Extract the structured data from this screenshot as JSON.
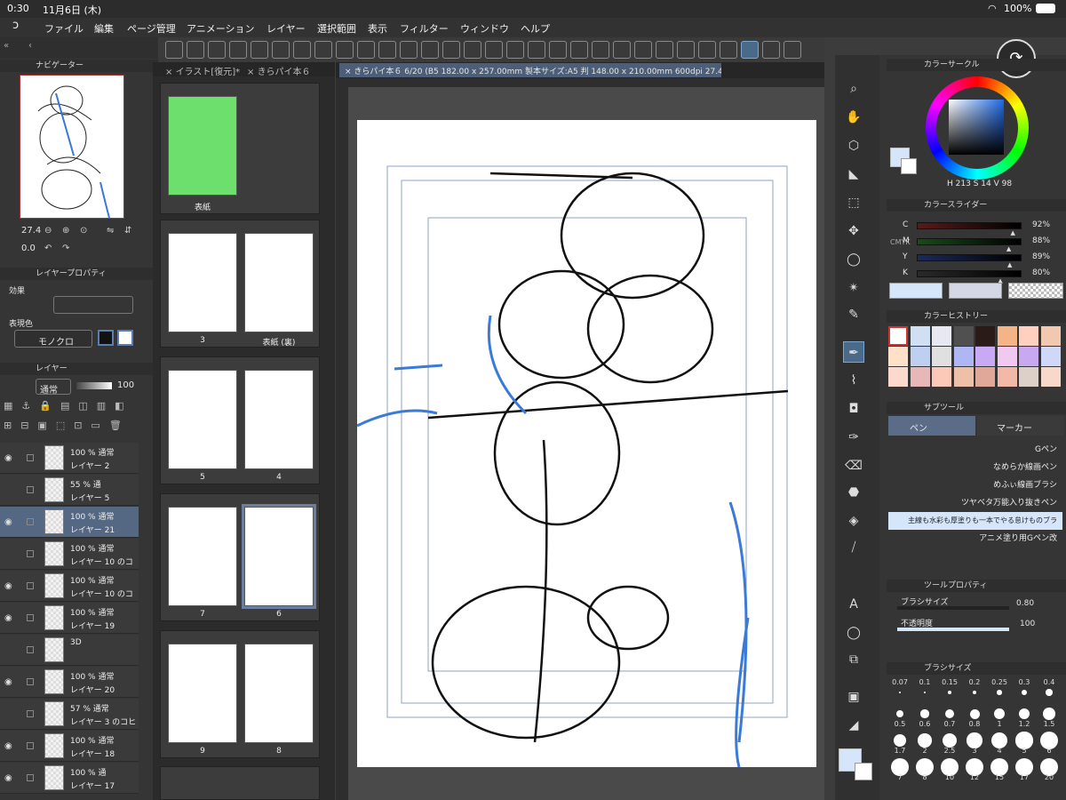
{
  "status": {
    "time": "0:30",
    "date": "11月6日 (木)",
    "battery": "100%"
  },
  "menu": [
    "ファイル",
    "編集",
    "ページ管理",
    "アニメーション",
    "レイヤー",
    "選択範囲",
    "表示",
    "フィルター",
    "ウィンドウ",
    "ヘルプ"
  ],
  "navigator": {
    "title": "ナビゲーター",
    "zoom": "27.4",
    "rotation": "0.0"
  },
  "layer_property": {
    "title": "レイヤープロパティ",
    "effect_label": "効果",
    "color_label": "表現色",
    "color_value": "モノクロ"
  },
  "layers_panel": {
    "title": "レイヤー",
    "blend": "通常",
    "opacity": "100"
  },
  "layers": [
    {
      "mode": "100 % 通常",
      "name": "レイヤー 2",
      "visible": true
    },
    {
      "mode": "55 % 通",
      "name": "レイヤー 5",
      "visible": false
    },
    {
      "mode": "100 % 通常",
      "name": "レイヤー 21",
      "visible": true,
      "selected": true
    },
    {
      "mode": "100 % 通常",
      "name": "レイヤー 10 のコ",
      "visible": false
    },
    {
      "mode": "100 % 通常",
      "name": "レイヤー 10 のコ",
      "visible": true
    },
    {
      "mode": "100 % 通常",
      "name": "レイヤー 19",
      "visible": true
    },
    {
      "mode": "3D",
      "name": "",
      "visible": false
    },
    {
      "mode": "100 % 通常",
      "name": "レイヤー 20",
      "visible": true
    },
    {
      "mode": "57 % 通常",
      "name": "レイヤー 3 のコヒ",
      "visible": false
    },
    {
      "mode": "100 % 通常",
      "name": "レイヤー 18",
      "visible": true
    },
    {
      "mode": "100 % 通",
      "name": "レイヤー 17",
      "visible": true
    }
  ],
  "tabs": [
    "イラスト[復元]*",
    "きらパイ本６"
  ],
  "doc_tab": "きらパイ本６ 6/20 (B5 182.00 x 257.00mm 製本サイズ:A5 判 148.00 x 210.00mm 600dpi 27.4%)",
  "pages": [
    {
      "label": "表紙"
    },
    {
      "label": "3"
    },
    {
      "label": "表紙 (裏)"
    },
    {
      "label": "5"
    },
    {
      "label": "4"
    },
    {
      "label": "7"
    },
    {
      "label": "6"
    },
    {
      "label": "9"
    },
    {
      "label": "8"
    }
  ],
  "color_circle": {
    "title": "カラーサークル",
    "h": "213",
    "s": "14",
    "v": "98"
  },
  "color_slider": {
    "title": "カラースライダー",
    "mode": "CMYK",
    "rows": [
      {
        "k": "C",
        "v": "92%",
        "frac": 0.92,
        "color": "#5a1a1a"
      },
      {
        "k": "M",
        "v": "88%",
        "frac": 0.88,
        "color": "#1a4a1a"
      },
      {
        "k": "Y",
        "v": "89%",
        "frac": 0.89,
        "color": "#1a2a5a"
      },
      {
        "k": "K",
        "v": "80%",
        "frac": 0.8,
        "color": "#2a2a2a"
      }
    ]
  },
  "color_history": {
    "title": "カラーヒストリー",
    "colors": [
      "#fff",
      "#d0dff4",
      "#e8e8f2",
      "#505050",
      "#2a1a18",
      "#f4b488",
      "#ffd0c0",
      "#f2c8b0",
      "#ffe0c8",
      "#bfcff0",
      "#e0e0e0",
      "#aeb6f4",
      "#c8aaf4",
      "#f0c8f0",
      "#c8a8f0",
      "#d0d8f8",
      "#fdd8cc",
      "#e8b8b8",
      "#fcc8b8",
      "#eec0a8",
      "#e0a898",
      "#f2b8a8",
      "#ddd0c8",
      "#f8d8c8"
    ]
  },
  "subtool": {
    "title": "サブツール",
    "tab_pen": "ペン",
    "tab_marker": "マーカー",
    "items": [
      "Gペン",
      "なめらか線画ペン",
      "めふぃ線画ブラシ",
      "ツヤベタ万能入り抜きペン",
      "主線も水彩も厚塗りも一本でやる怠けものブラ",
      "アニメ塗り用Gペン改"
    ]
  },
  "tool_property": {
    "title": "ツールプロパティ",
    "brush_size_label": "ブラシサイズ",
    "brush_size": "0.80",
    "opacity_label": "不透明度",
    "opacity": "100"
  },
  "brush_sizes": {
    "title": "ブラシサイズ",
    "values": [
      "0.07",
      "0.1",
      "0.15",
      "0.2",
      "0.25",
      "0.3",
      "0.4",
      "0.5",
      "0.6",
      "0.7",
      "0.8",
      "1",
      "1.2",
      "1.5",
      "1.7",
      "2",
      "2.5",
      "3",
      "4",
      "5",
      "6",
      "7",
      "8",
      "10",
      "12",
      "15",
      "17",
      "20"
    ]
  }
}
